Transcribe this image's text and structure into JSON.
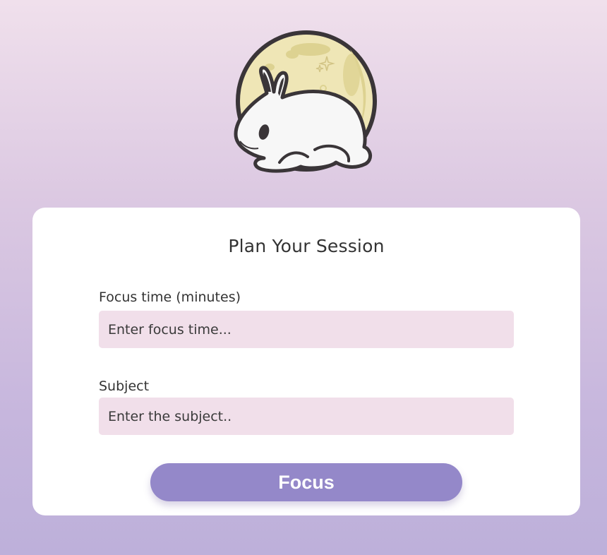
{
  "logo": {
    "name": "bunny-moon-logo"
  },
  "form": {
    "title": "Plan Your Session",
    "focus_time": {
      "label": "Focus time (minutes)",
      "placeholder": "Enter focus time...",
      "value": ""
    },
    "subject": {
      "label": "Subject",
      "placeholder": "Enter the subject..",
      "value": ""
    },
    "submit_label": "Focus"
  },
  "colors": {
    "background_top": "#f0e0ec",
    "background_bottom": "#bdb0da",
    "input_bg": "#f1dfea",
    "button_bg": "#9488c9",
    "moon": "#efe6b6",
    "outline": "#3a3538"
  }
}
